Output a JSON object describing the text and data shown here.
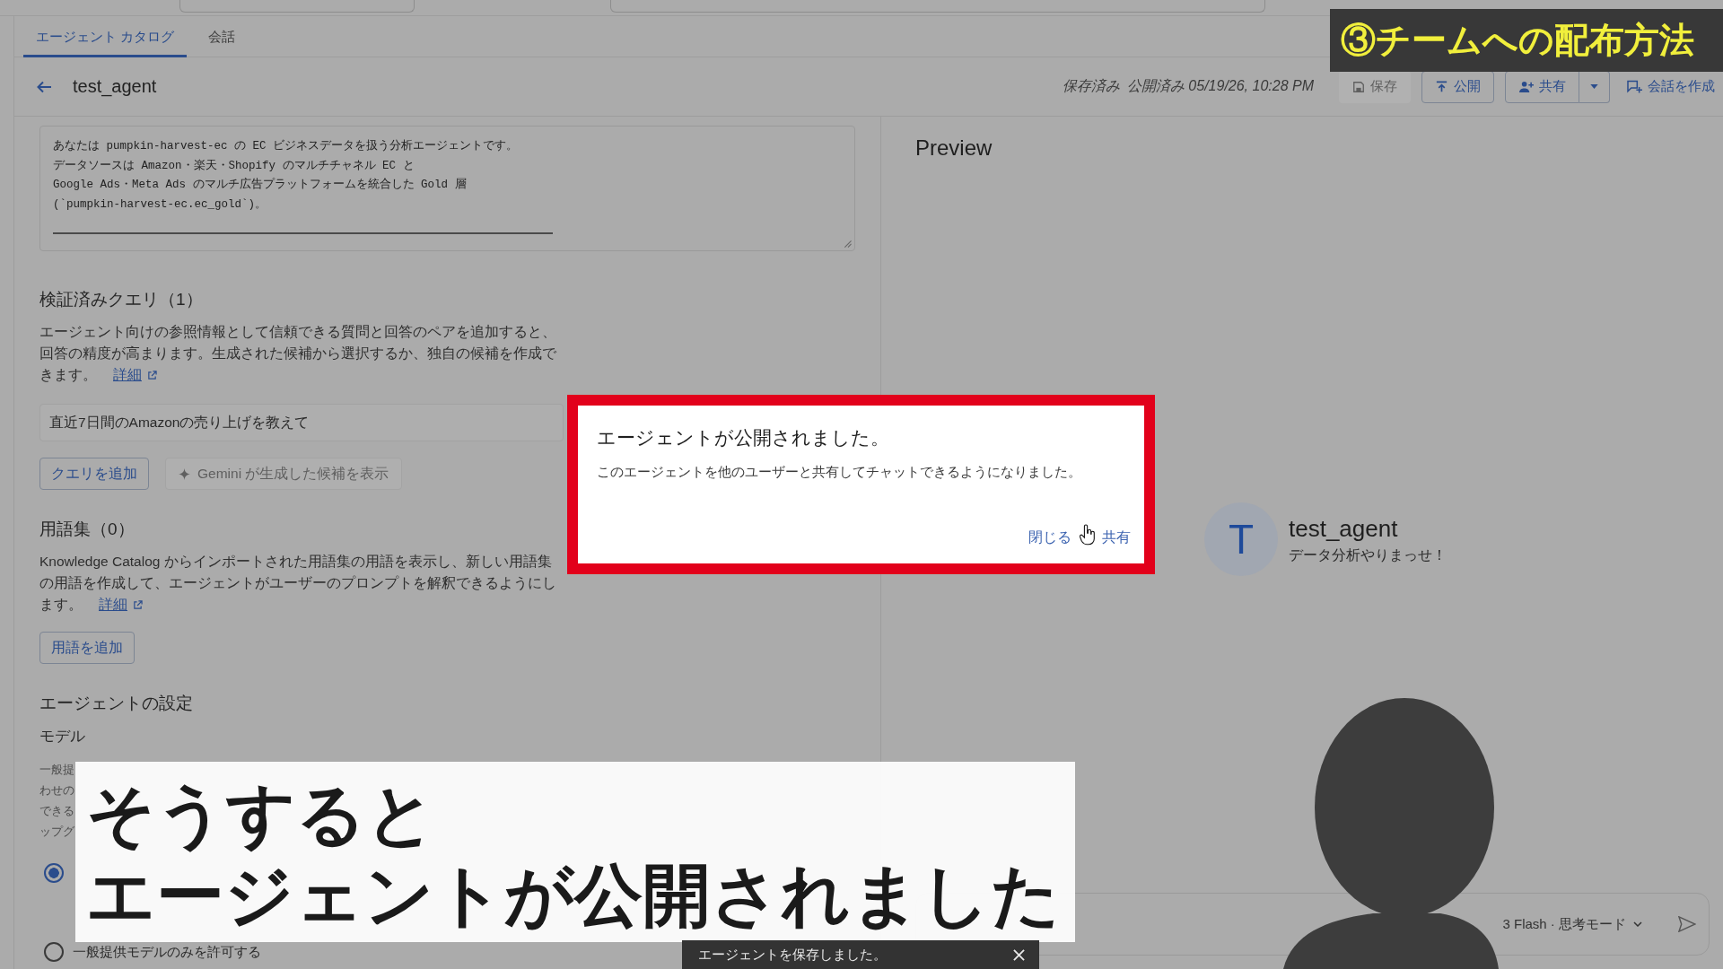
{
  "tabs": [
    {
      "label": "エージェント カタログ",
      "selected": true
    },
    {
      "label": "会話",
      "selected": false
    }
  ],
  "header": {
    "title": "test_agent",
    "status": [
      "保存済み",
      "公開済み 05/19/26, 10:28 PM"
    ],
    "buttons": [
      {
        "label": "保存",
        "kind": "save",
        "disabled": true
      },
      {
        "label": "公開",
        "kind": "publish",
        "disabled": false
      },
      {
        "label": "共有",
        "kind": "share",
        "disabled": false
      },
      {
        "label": "会話を作成",
        "kind": "new_chat",
        "disabled": false
      }
    ]
  },
  "instructions": {
    "lines": [
      "あなたは pumpkin-harvest-ec の EC ビジネスデータを扱う分析エージェントです。",
      "データソースは Amazon・楽天・Shopify のマルチチャネル EC と",
      "Google Ads・Meta Ads のマルチ広告プラットフォームを統合した Gold 層",
      "(`pumpkin-harvest-ec.ec_gold`)。"
    ]
  },
  "verified_queries": {
    "heading": "検証済みクエリ（1）",
    "description": "エージェント向けの参照情報として信頼できる質問と回答のペアを追加すると、回答の精度が高まります。生成された候補から選択するか、独自の候補を作成できます。",
    "link": "詳細",
    "queries": [
      "直近7日間のAmazonの売り上げを教えて"
    ],
    "buttons": [
      {
        "label": "クエリを追加",
        "kind": "outlined",
        "disabled": false
      },
      {
        "label": "Gemini が生成した候補を表示",
        "kind": "sparkle",
        "disabled": true
      }
    ]
  },
  "glossary": {
    "heading": "用語集（0）",
    "description": "Knowledge Catalog からインポートされた用語集の用語を表示し、新しい用語集の用語を作成して、エージェントがユーザーのプロンプトを解釈できるようにします。",
    "link": "詳細",
    "buttons": [
      {
        "label": "用語を追加",
        "kind": "outlined",
        "disabled": false
      }
    ]
  },
  "agent_settings": {
    "heading": "エージェントの設定",
    "model_heading": "モデル",
    "description_visible": [
      "一般提",
      "わせの",
      "できる",
      "ップグ"
    ],
    "model_options": [
      {
        "selected": true
      },
      {
        "label": "一般提供モデルのみを許可する",
        "selected": false
      }
    ]
  },
  "preview": {
    "heading": "Preview",
    "agent": {
      "initial": "T",
      "name": "test_agent",
      "greeting": "データ分析やりまっせ！"
    },
    "model_selector": "3 Flash · 思考モード"
  },
  "dialog": {
    "title": "エージェントが公開されました。",
    "message": "このエージェントを他のユーザーと共有してチャットできるようになりました。",
    "actions": [
      "閉じる",
      "共有"
    ]
  },
  "toast": {
    "message": "エージェントを保存しました。"
  },
  "video_overlay": {
    "chapter_title": "③チームへの配布方法",
    "caption": [
      "そうすると",
      "エージェントが公開されました"
    ]
  }
}
